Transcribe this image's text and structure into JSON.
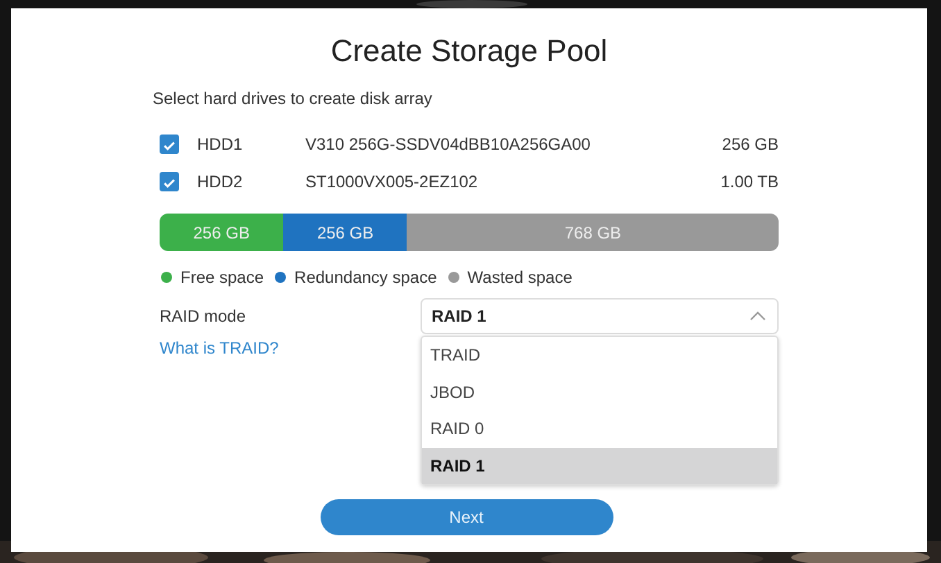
{
  "dialog": {
    "title": "Create Storage Pool",
    "subtitle": "Select hard drives to create disk array"
  },
  "drives": [
    {
      "name": "HDD1",
      "model": "V310 256G-SSDV04dBB10A256GA00",
      "size": "256 GB",
      "checked": true
    },
    {
      "name": "HDD2",
      "model": "ST1000VX005-2EZ102",
      "size": "1.00 TB",
      "checked": true
    }
  ],
  "capacity_bar": [
    {
      "label": "256 GB",
      "color": "#3cb04a"
    },
    {
      "label": "256 GB",
      "color": "#1f73c0"
    },
    {
      "label": "768 GB",
      "color": "#999999"
    }
  ],
  "legend": [
    {
      "label": "Free space",
      "color": "#3cb04a"
    },
    {
      "label": "Redundancy space",
      "color": "#1f73c0"
    },
    {
      "label": "Wasted space",
      "color": "#999999"
    }
  ],
  "raid_mode": {
    "label": "RAID mode",
    "value": "RAID 1",
    "expanded": true,
    "help_link": "What is TRAID?",
    "options": [
      {
        "label": "TRAID",
        "selected": false
      },
      {
        "label": "JBOD",
        "selected": false
      },
      {
        "label": "RAID 0",
        "selected": false
      },
      {
        "label": "RAID 1",
        "selected": true
      }
    ]
  },
  "buttons": [
    "Next"
  ]
}
